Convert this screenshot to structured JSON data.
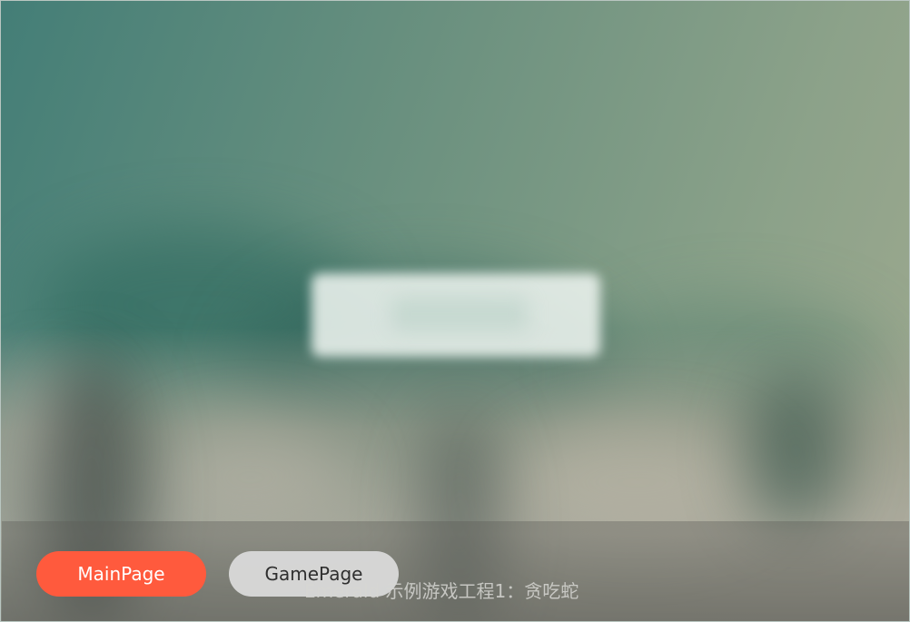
{
  "nav": {
    "main_label": "MainPage",
    "game_label": "GamePage"
  },
  "footer": {
    "caption": "Emerald 示例游戏工程1：贪吃蛇"
  },
  "colors": {
    "active_button": "#ff5a3d",
    "inactive_button": "#dcdcdc"
  }
}
